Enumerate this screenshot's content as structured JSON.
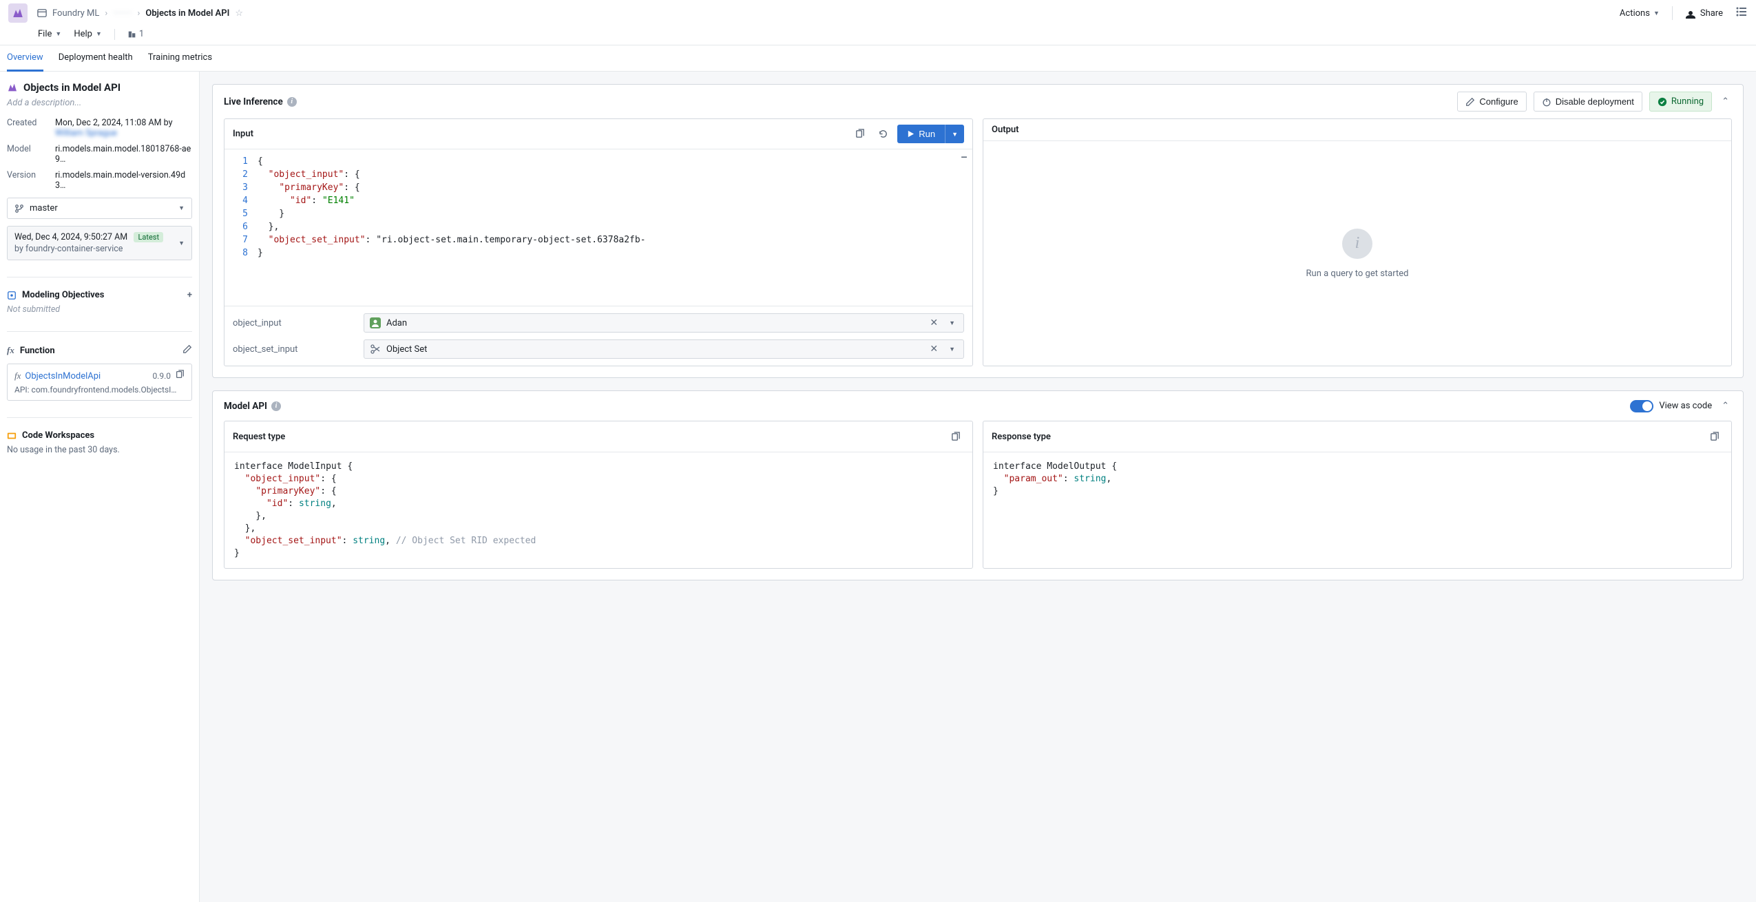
{
  "header": {
    "breadcrumb": {
      "root": "Foundry ML",
      "middle": "········",
      "current": "Objects in Model API"
    },
    "actions_label": "Actions",
    "share_label": "Share"
  },
  "menubar": {
    "file": "File",
    "help": "Help",
    "count": "1"
  },
  "tabs": {
    "overview": "Overview",
    "deployment_health": "Deployment health",
    "training_metrics": "Training metrics"
  },
  "sidebar": {
    "title": "Objects in Model API",
    "description_placeholder": "Add a description...",
    "created_label": "Created",
    "created_value": "Mon, Dec 2, 2024, 11:08 AM by",
    "created_author": "William Sprague",
    "model_label": "Model",
    "model_value": "ri.models.main.model.18018768-ae9…",
    "version_label": "Version",
    "version_value": "ri.models.main.model-version.49d3…",
    "branch": "master",
    "version_time": "Wed, Dec 4, 2024, 9:50:27 AM",
    "version_latest": "Latest",
    "version_by": "by foundry-container-service",
    "objectives_title": "Modeling Objectives",
    "objectives_sub": "Not submitted",
    "function_title": "Function",
    "function_name": "ObjectsInModelApi",
    "function_version": "0.9.0",
    "function_api": "API: com.foundryfrontend.models.ObjectsI…",
    "workspaces_title": "Code Workspaces",
    "workspaces_sub": "No usage in the past 30 days."
  },
  "live_inference": {
    "title": "Live Inference",
    "configure": "Configure",
    "disable": "Disable deployment",
    "running": "Running",
    "input_title": "Input",
    "run_label": "Run",
    "code_lines": [
      "{",
      "  \"object_input\": {",
      "    \"primaryKey\": {",
      "      \"id\": \"E141\"",
      "    }",
      "  },",
      "  \"object_set_input\": \"ri.object-set.main.temporary-object-set.6378a2fb-",
      "}"
    ],
    "line_numbers": [
      "1",
      "2",
      "3",
      "4",
      "5",
      "6",
      "7",
      "8"
    ],
    "params": {
      "object_input": {
        "label": "object_input",
        "value": "Adan"
      },
      "object_set_input": {
        "label": "object_set_input",
        "value": "Object Set"
      }
    },
    "output_title": "Output",
    "output_empty": "Run a query to get started"
  },
  "model_api": {
    "title": "Model API",
    "view_as_code": "View as code",
    "request_title": "Request type",
    "response_title": "Response type",
    "request_code": "interface ModelInput {\n  \"object_input\": {\n    \"primaryKey\": {\n      \"id\": string,\n    },\n  },\n  \"object_set_input\": string, // Object Set RID expected\n}",
    "response_code": "interface ModelOutput {\n  \"param_out\": string,\n}"
  }
}
